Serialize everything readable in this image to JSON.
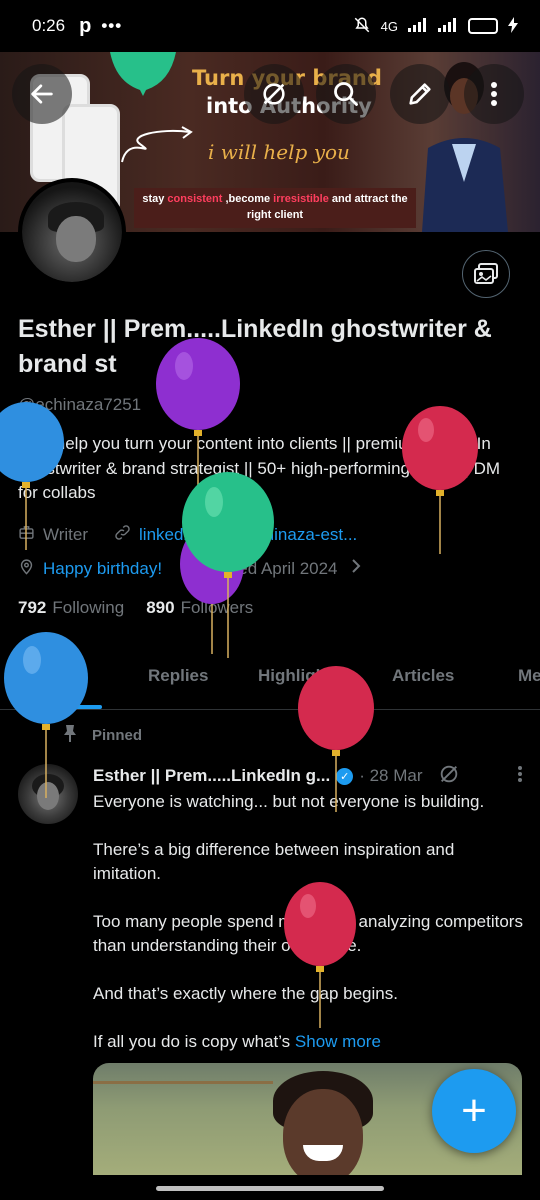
{
  "status_bar": {
    "time": "0:26",
    "app_letter": "p",
    "more_dots": "•••",
    "network": "4G",
    "battery_level": "63"
  },
  "banner": {
    "headline_line1": "Turn your brand",
    "headline_line2": "into Authority",
    "script_text": "i will help you",
    "tagline_part1": "stay ",
    "tagline_hl1": "consistent",
    "tagline_part2": " ,become ",
    "tagline_hl2": "irresistible",
    "tagline_part3": " and attract the right client"
  },
  "profile": {
    "name": "Esther || Prem.....LinkedIn ghostwriter & brand st",
    "handle": "@echinaza7251",
    "bio": "I will help you turn your content into clients || premium LinkedIn ghostwriter & brand strategist || 50+ high-performing posts || DM for collabs",
    "category": "Writer",
    "link": "linkedin.com/in/chinaza-est...",
    "birthday": "Happy birthday!",
    "joined": "Joined April 2024",
    "following_count": "792",
    "following_label": "Following",
    "followers_count": "890",
    "followers_label": "Followers"
  },
  "tabs": [
    {
      "label": "Posts",
      "active": true
    },
    {
      "label": "Replies",
      "active": false
    },
    {
      "label": "Highlights",
      "active": false
    },
    {
      "label": "Articles",
      "active": false
    },
    {
      "label": "Me",
      "active": false
    }
  ],
  "pinned_post": {
    "pinned_label": "Pinned",
    "author": "Esther || Prem.....LinkedIn g...",
    "date": "· 28 Mar",
    "paragraphs": [
      "Everyone is watching... but not everyone is building.",
      "There’s a big difference between inspiration and imitation.",
      "Too many people spend more time analyzing competitors than understanding their own voice.",
      "And that’s exactly where the gap begins."
    ],
    "last_line": "If all you do is copy what’s",
    "show_more": "Show more"
  },
  "fab_label": "+",
  "colors": {
    "accent": "#1d9bf0",
    "muted_text": "#71767b",
    "primary_text": "#e7e9ea",
    "background": "#000000",
    "balloon_purple": "#8e2fd0",
    "balloon_red": "#d42a4e",
    "balloon_blue": "#2f8fe0",
    "balloon_green": "#27c08a"
  }
}
